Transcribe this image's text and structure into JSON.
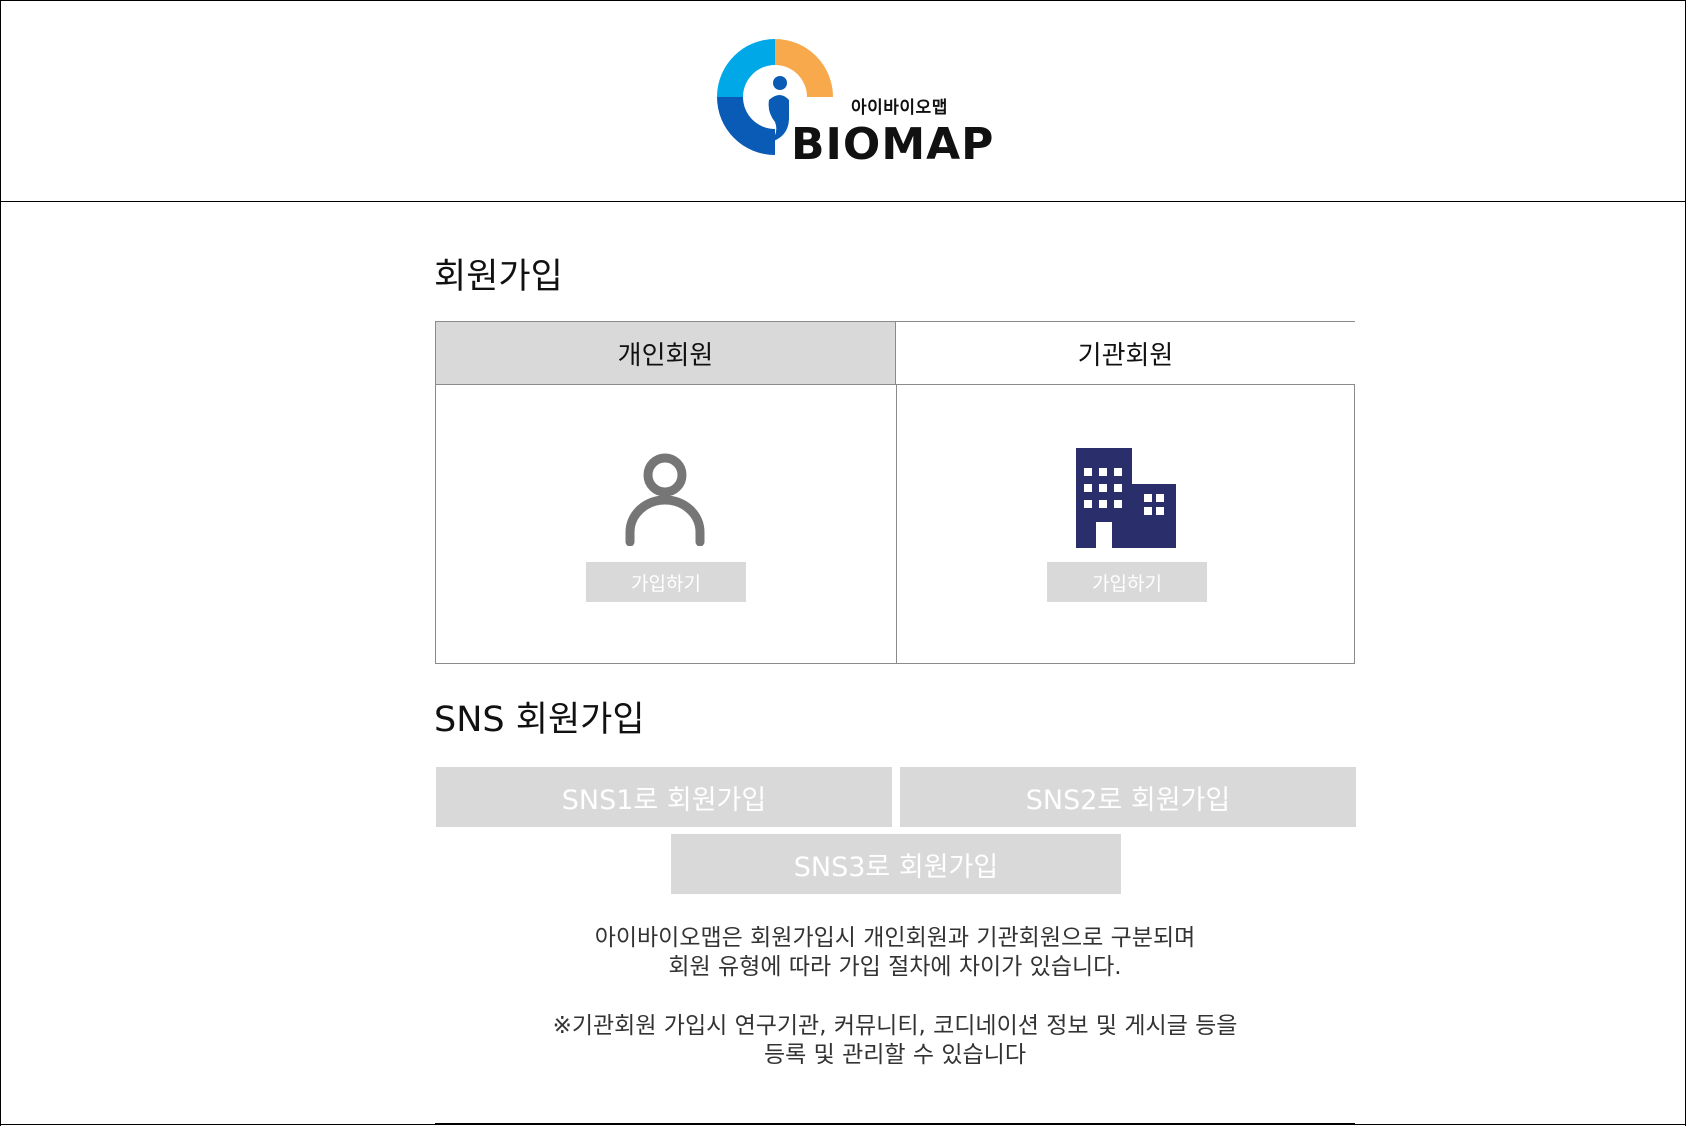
{
  "header": {
    "logo_sub": "아이바이오맵",
    "logo_main": "BIOMAP",
    "logo_colors": {
      "cyan": "#00a8e8",
      "orange": "#f7a94c",
      "blue": "#0a5bb5"
    }
  },
  "signup": {
    "title": "회원가입",
    "tabs": [
      {
        "label": "개인회원",
        "selected": true
      },
      {
        "label": "기관회원",
        "selected": false
      }
    ],
    "personal_icon": "person-icon",
    "org_icon": "building-icon",
    "join_label_personal": "가입하기",
    "join_label_org": "가입하기"
  },
  "sns": {
    "title": "SNS 회원가입",
    "buttons": [
      {
        "label": "SNS1로 회원가입"
      },
      {
        "label": "SNS2로 회원가입"
      },
      {
        "label": "SNS3로 회원가입"
      }
    ]
  },
  "info": {
    "line1": "아이바이오맵은 회원가입시 개인회원과 기관회원으로 구분되며",
    "line2": "회원 유형에 따라 가입 절차에 차이가 있습니다.",
    "note1": "※기관회원 가입시 연구기관, 커뮤니티, 코디네이션 정보 및 게시글 등을",
    "note2": "등록 및 관리할 수 있습니다"
  },
  "colors": {
    "selected_tab_bg": "#d9d9d9",
    "button_bg": "#d9d9d9",
    "person_icon": "#767676",
    "building_icon": "#2a2f6b"
  }
}
